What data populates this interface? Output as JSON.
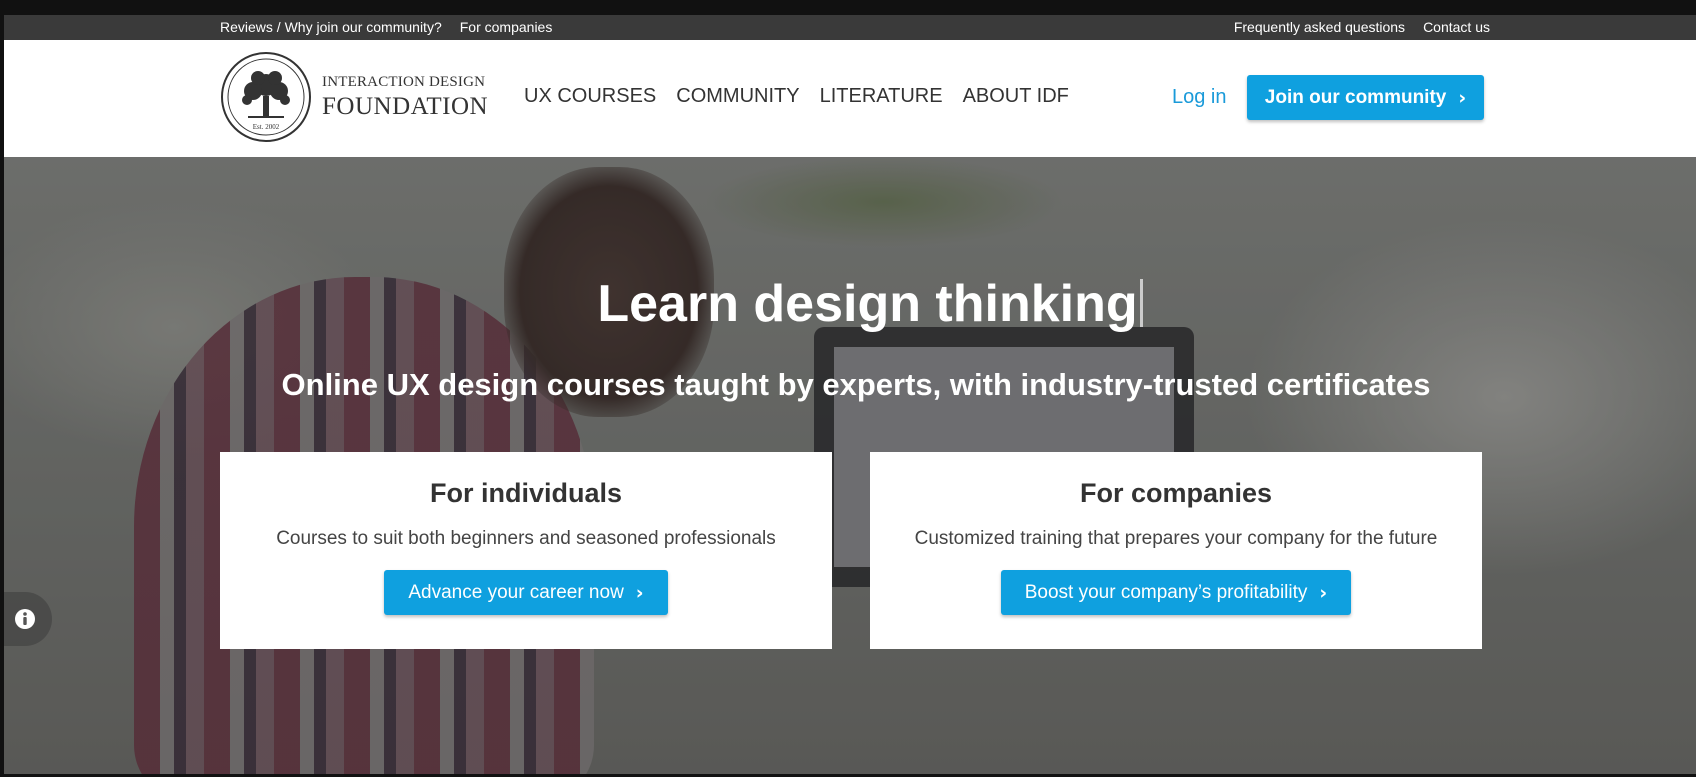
{
  "topbar": {
    "reviews_link": "Reviews / Why join our community?",
    "companies_link": "For companies",
    "faq_link": "Frequently asked questions",
    "contact_link": "Contact us"
  },
  "header": {
    "logo_line1": "INTERACTION DESIGN",
    "logo_line2": "FOUNDATION",
    "logo_est": "Est. 2002",
    "nav": [
      "UX COURSES",
      "COMMUNITY",
      "LITERATURE",
      "ABOUT IDF"
    ],
    "login": "Log in",
    "join": "Join our community",
    "join_chevron": "›"
  },
  "hero": {
    "title": "Learn design thinking",
    "subtitle": "Online UX design courses taught by experts, with industry-trusted certificates",
    "individuals": {
      "heading": "For individuals",
      "text": "Courses to suit both beginners and seasoned professionals",
      "button": "Advance your career now",
      "chevron": "›"
    },
    "companies": {
      "heading": "For companies",
      "text": "Customized training that prepares your company for the future",
      "button": "Boost your company’s profitability",
      "chevron": "›"
    }
  },
  "colors": {
    "accent": "#0fa0df",
    "topbar": "#3a3a3a"
  }
}
